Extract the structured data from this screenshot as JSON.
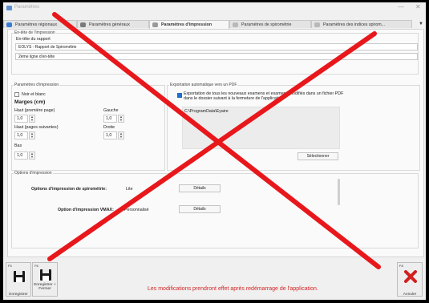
{
  "window": {
    "title": "Paramètres",
    "minimize": "—",
    "close": "✕"
  },
  "tabs": [
    {
      "label": "Paramètres régionaux"
    },
    {
      "label": "Paramètres généraux"
    },
    {
      "label": "Paramètres d'impression"
    },
    {
      "label": "Paramètres de spirométrie"
    },
    {
      "label": "Paramètres des indices spirom..."
    }
  ],
  "header_section": {
    "group_label": "En-tête de l'impression",
    "report_header_label": "En-tête du rapport",
    "line1_value": "EOLYS - Rapport de Spirométrie",
    "line2_value": "2ème ligne d'en-tête"
  },
  "print_params": {
    "group_label": "Paramètres d'impression",
    "bw_label": "Noir et blanc",
    "margins_label": "Marges (cm)",
    "top_first_label": "Haut (première page)",
    "top_first_value": "1,0",
    "left_label": "Gauche",
    "left_value": "1,0",
    "top_next_label": "Haut (pages suivantes)",
    "top_next_value": "1,0",
    "right_label": "Droite",
    "right_value": "1,0",
    "bottom_label": "Bas",
    "bottom_value": "1,0"
  },
  "pdf_export": {
    "group_label": "Exportation automatique vers un PDF",
    "description": "Exportation de tous les nouveaux examens et examens modifiés dans un fichier PDF dans le dossier suivant à la fermeture de l'application",
    "path": "C:\\ProgramData\\Eyaire",
    "select_button": "Sélectionner"
  },
  "print_options": {
    "group_label": "Options d'impression",
    "spiro_label": "Options d'impression de spirométrie:",
    "spiro_value": "Lite",
    "details1": "Détails",
    "vmax_label": "Option d'impression VMAX:",
    "vmax_value": "Personnalisé",
    "details2": "Détails"
  },
  "footer": {
    "save": {
      "key": "F5",
      "label": "Enregistrer"
    },
    "save_close": {
      "key": "F6",
      "label": "Enregistrer + Fermer"
    },
    "message": "Les modifications prendront effet après redémarrage de l'application.",
    "cancel": {
      "key": "F8",
      "label": "Annuler"
    }
  },
  "colors": {
    "accent": "#1e6fc8",
    "overlay_x": "#e8171b",
    "message": "#d32424"
  }
}
